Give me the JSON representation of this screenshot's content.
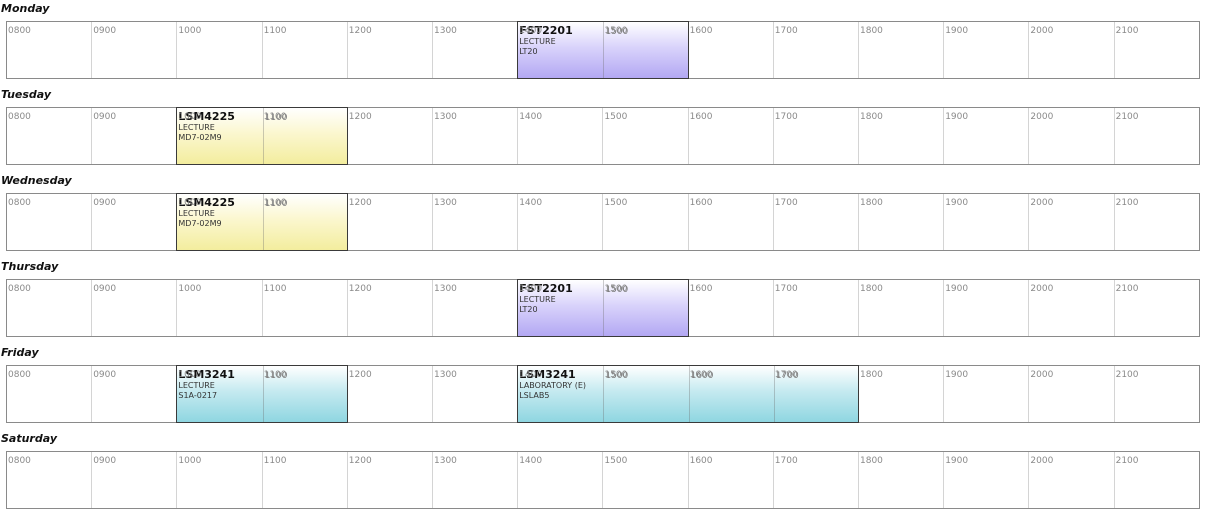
{
  "hours": [
    "0800",
    "0900",
    "1000",
    "1100",
    "1200",
    "1300",
    "1400",
    "1500",
    "1600",
    "1700",
    "1800",
    "1900",
    "2000",
    "2100"
  ],
  "days": [
    {
      "name": "Monday",
      "sessions": [
        {
          "code": "FST2201",
          "type": "LECTURE",
          "venue": "LT20",
          "start": "1400",
          "end": "1600",
          "color": "purple"
        }
      ]
    },
    {
      "name": "Tuesday",
      "sessions": [
        {
          "code": "LSM4225",
          "type": "LECTURE",
          "venue": "MD7-02M9",
          "start": "1000",
          "end": "1200",
          "color": "yellow"
        }
      ]
    },
    {
      "name": "Wednesday",
      "sessions": [
        {
          "code": "LSM4225",
          "type": "LECTURE",
          "venue": "MD7-02M9",
          "start": "1000",
          "end": "1200",
          "color": "yellow"
        }
      ]
    },
    {
      "name": "Thursday",
      "sessions": [
        {
          "code": "FST2201",
          "type": "LECTURE",
          "venue": "LT20",
          "start": "1400",
          "end": "1600",
          "color": "purple"
        }
      ]
    },
    {
      "name": "Friday",
      "sessions": [
        {
          "code": "LSM3241",
          "type": "LECTURE",
          "venue": "S1A-0217",
          "start": "1000",
          "end": "1200",
          "color": "cyan"
        },
        {
          "code": "LSM3241",
          "type": "LABORATORY (E)",
          "venue": "LSLAB5",
          "start": "1400",
          "end": "1800",
          "color": "cyan"
        }
      ]
    },
    {
      "name": "Saturday",
      "sessions": []
    }
  ],
  "colors": {
    "purple": "#b3a8f3",
    "yellow": "#f3ed9e",
    "cyan": "#8fd6e1"
  }
}
